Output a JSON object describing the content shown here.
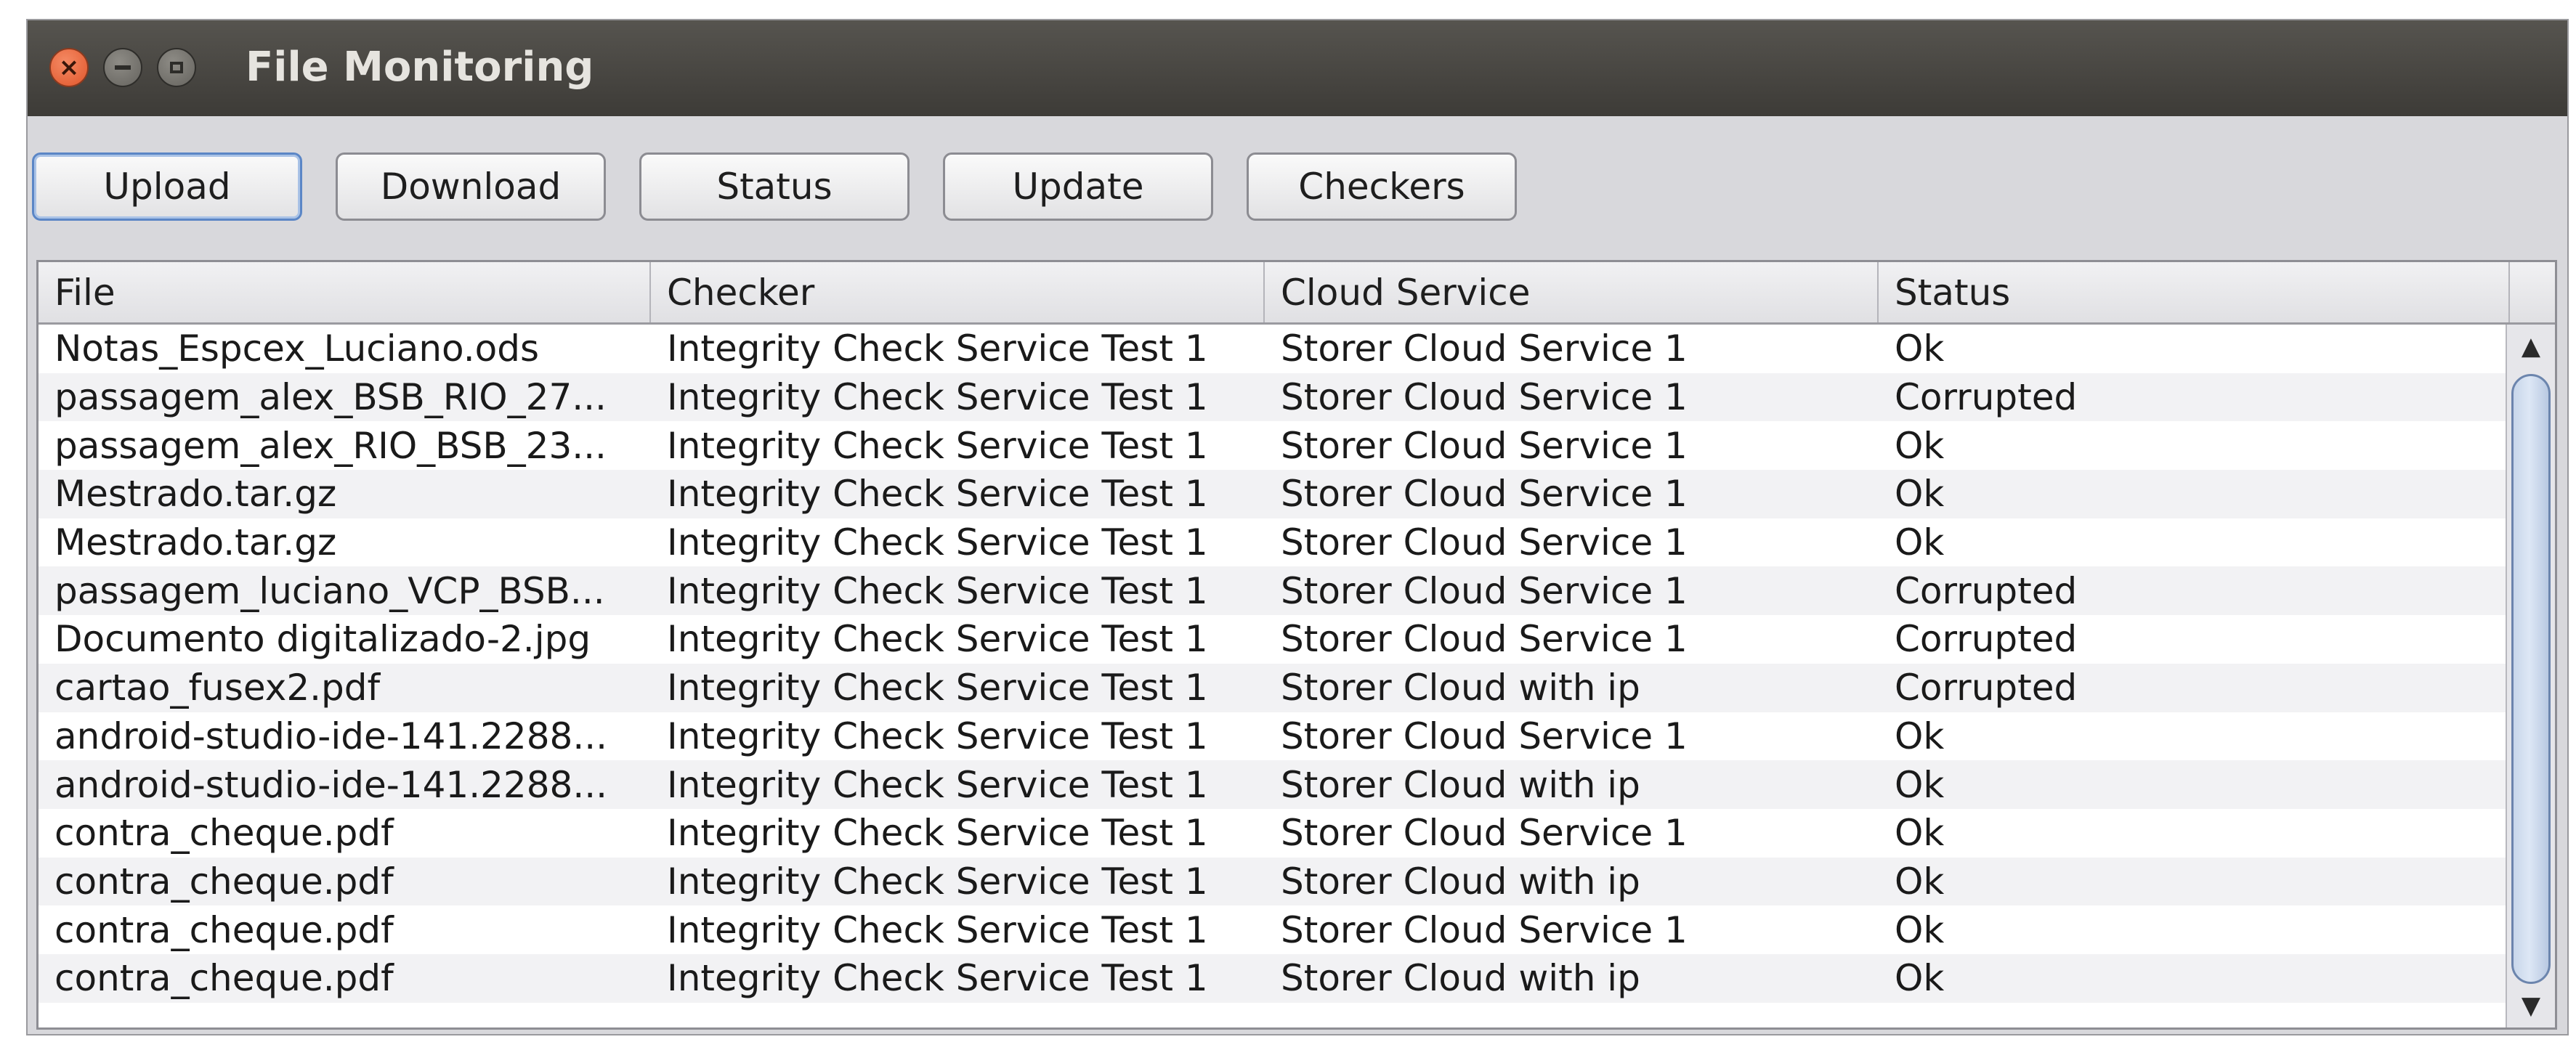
{
  "window": {
    "title": "File Monitoring",
    "close_glyph": "×"
  },
  "toolbar": {
    "buttons": [
      {
        "label": "Upload"
      },
      {
        "label": "Download"
      },
      {
        "label": "Status"
      },
      {
        "label": "Update"
      },
      {
        "label": "Checkers"
      }
    ]
  },
  "table": {
    "columns": [
      "File",
      "Checker",
      "Cloud Service",
      "Status"
    ],
    "rows": [
      {
        "file": "Notas_Espcex_Luciano.ods",
        "checker": "Integrity Check Service Test 1",
        "cloud": "Storer Cloud Service 1",
        "status": "Ok"
      },
      {
        "file": "passagem_alex_BSB_RIO_27...",
        "checker": "Integrity Check Service Test 1",
        "cloud": "Storer Cloud Service 1",
        "status": "Corrupted"
      },
      {
        "file": "passagem_alex_RIO_BSB_23...",
        "checker": "Integrity Check Service Test 1",
        "cloud": "Storer Cloud Service 1",
        "status": "Ok"
      },
      {
        "file": "Mestrado.tar.gz",
        "checker": "Integrity Check Service Test 1",
        "cloud": "Storer Cloud Service 1",
        "status": "Ok"
      },
      {
        "file": "Mestrado.tar.gz",
        "checker": "Integrity Check Service Test 1",
        "cloud": "Storer Cloud Service 1",
        "status": "Ok"
      },
      {
        "file": "passagem_luciano_VCP_BSB...",
        "checker": "Integrity Check Service Test 1",
        "cloud": "Storer Cloud Service 1",
        "status": "Corrupted"
      },
      {
        "file": "Documento digitalizado-2.jpg",
        "checker": "Integrity Check Service Test 1",
        "cloud": "Storer Cloud Service 1",
        "status": "Corrupted"
      },
      {
        "file": "cartao_fusex2.pdf",
        "checker": "Integrity Check Service Test 1",
        "cloud": "Storer Cloud with ip",
        "status": "Corrupted"
      },
      {
        "file": "android-studio-ide-141.2288...",
        "checker": "Integrity Check Service Test 1",
        "cloud": "Storer Cloud Service 1",
        "status": "Ok"
      },
      {
        "file": "android-studio-ide-141.2288...",
        "checker": "Integrity Check Service Test 1",
        "cloud": "Storer Cloud with ip",
        "status": "Ok"
      },
      {
        "file": "contra_cheque.pdf",
        "checker": "Integrity Check Service Test 1",
        "cloud": "Storer Cloud Service 1",
        "status": "Ok"
      },
      {
        "file": "contra_cheque.pdf",
        "checker": "Integrity Check Service Test 1",
        "cloud": "Storer Cloud with ip",
        "status": "Ok"
      },
      {
        "file": "contra_cheque.pdf",
        "checker": "Integrity Check Service Test 1",
        "cloud": "Storer Cloud Service 1",
        "status": "Ok"
      },
      {
        "file": "contra_cheque.pdf",
        "checker": "Integrity Check Service Test 1",
        "cloud": "Storer Cloud with ip",
        "status": "Ok"
      }
    ]
  },
  "scrollbar": {
    "up_glyph": "▲",
    "down_glyph": "▼"
  }
}
